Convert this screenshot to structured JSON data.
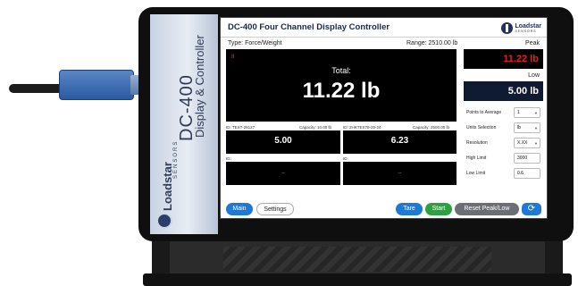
{
  "app": {
    "title": "DC-400 Four Channel Display Controller",
    "brand": "Loadstar",
    "brand_sub": "SENSORS"
  },
  "device": {
    "model": "DC-400",
    "subtitle": "Display & Controller",
    "brand": "Loadstar",
    "brand_sub": "SENSORS"
  },
  "header": {
    "type_label": "Type: Force/Weight",
    "range_label": "Range: 2510.00 lb"
  },
  "total": {
    "indicator": "II",
    "label": "Total:",
    "value": "11.22 lb"
  },
  "channels": [
    {
      "id": "ID: TEST-28127",
      "capacity": "Capacity: 10.00 lb",
      "value": "5.00"
    },
    {
      "id": "ID: 2HKTES78-25-24",
      "capacity": "Capacity: 2500.00 lb",
      "value": "6.23"
    },
    {
      "id": "ID:",
      "capacity": "",
      "value": "--"
    },
    {
      "id": "ID:",
      "capacity": "",
      "value": "--"
    }
  ],
  "peak": {
    "label": "Peak",
    "value": "11.22 lb"
  },
  "low": {
    "label": "Low",
    "value": "5.00 lb"
  },
  "settings": [
    {
      "label": "Points to Average",
      "value": "1"
    },
    {
      "label": "Units Selection",
      "value": "lb"
    },
    {
      "label": "Resolution",
      "value": "X.XX"
    },
    {
      "label": "High Limit",
      "value": "3000"
    },
    {
      "label": "Low Limit",
      "value": "0.6"
    }
  ],
  "buttons": {
    "main": "Main",
    "settings": "Settings",
    "tare": "Tare",
    "start": "Start",
    "reset": "Reset Peak/Low",
    "refresh": "⟳"
  },
  "colors": {
    "primary_button": "#1e78d6",
    "start_button": "#2ea043",
    "reset_button": "#6b6f75",
    "peak_value": "#e02020",
    "panel_background": "#000000"
  }
}
